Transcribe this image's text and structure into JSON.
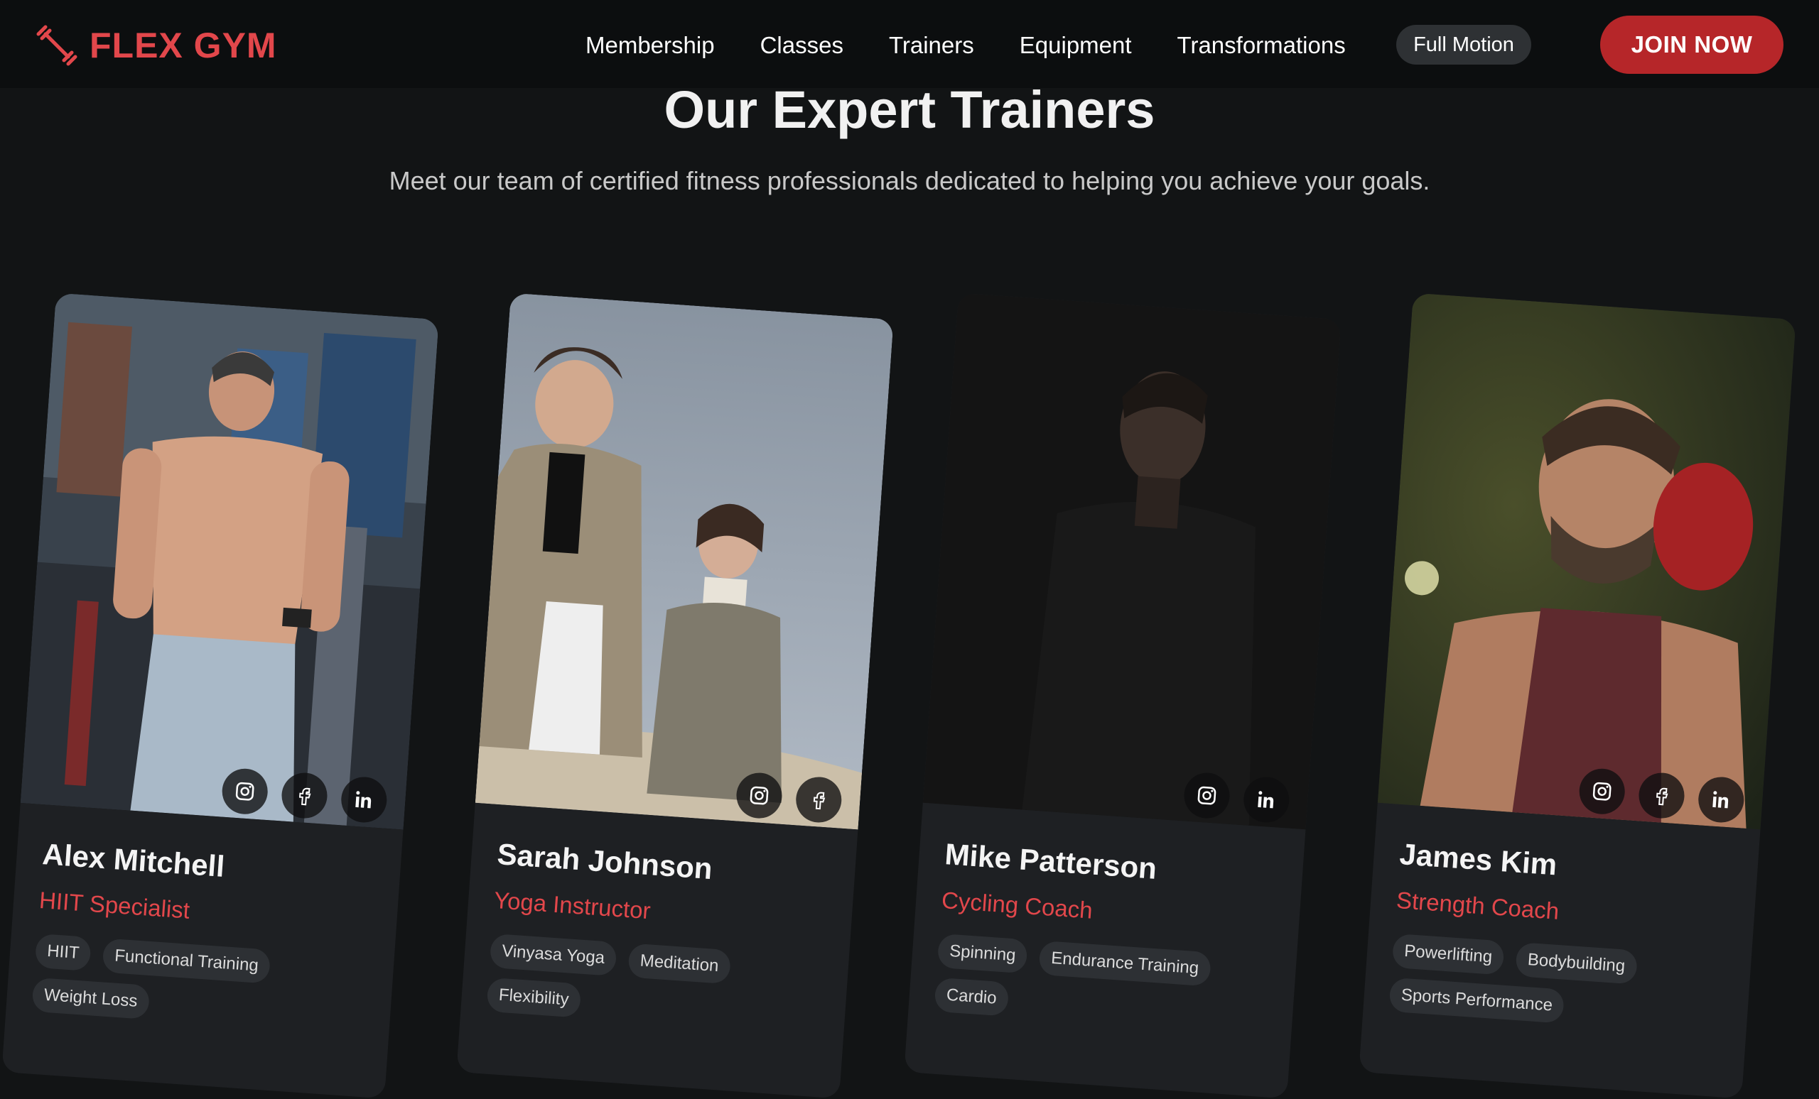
{
  "brand": {
    "name": "FLEX GYM",
    "icon": "dumbbell-icon",
    "accent": "#e2474b"
  },
  "nav": {
    "links": [
      "Membership",
      "Classes",
      "Trainers",
      "Equipment",
      "Transformations"
    ],
    "pill": "Full Motion",
    "cta": "JOIN NOW",
    "cta_color": "#b62629"
  },
  "section": {
    "title": "Our Expert Trainers",
    "subtitle": "Meet our team of certified fitness professionals dedicated to helping you achieve your goals."
  },
  "trainers": [
    {
      "name": "Alex Mitchell",
      "role": "HIIT Specialist",
      "tags": [
        "HIIT",
        "Functional Training",
        "Weight Loss"
      ],
      "socials": [
        "instagram-icon",
        "facebook-icon",
        "linkedin-icon"
      ]
    },
    {
      "name": "Sarah Johnson",
      "role": "Yoga Instructor",
      "tags": [
        "Vinyasa Yoga",
        "Meditation",
        "Flexibility"
      ],
      "socials": [
        "instagram-icon",
        "facebook-icon"
      ]
    },
    {
      "name": "Mike Patterson",
      "role": "Cycling Coach",
      "tags": [
        "Spinning",
        "Endurance Training",
        "Cardio"
      ],
      "socials": [
        "instagram-icon",
        "linkedin-icon"
      ]
    },
    {
      "name": "James Kim",
      "role": "Strength Coach",
      "tags": [
        "Powerlifting",
        "Bodybuilding",
        "Sports Performance"
      ],
      "socials": [
        "instagram-icon",
        "facebook-icon",
        "linkedin-icon"
      ]
    }
  ]
}
